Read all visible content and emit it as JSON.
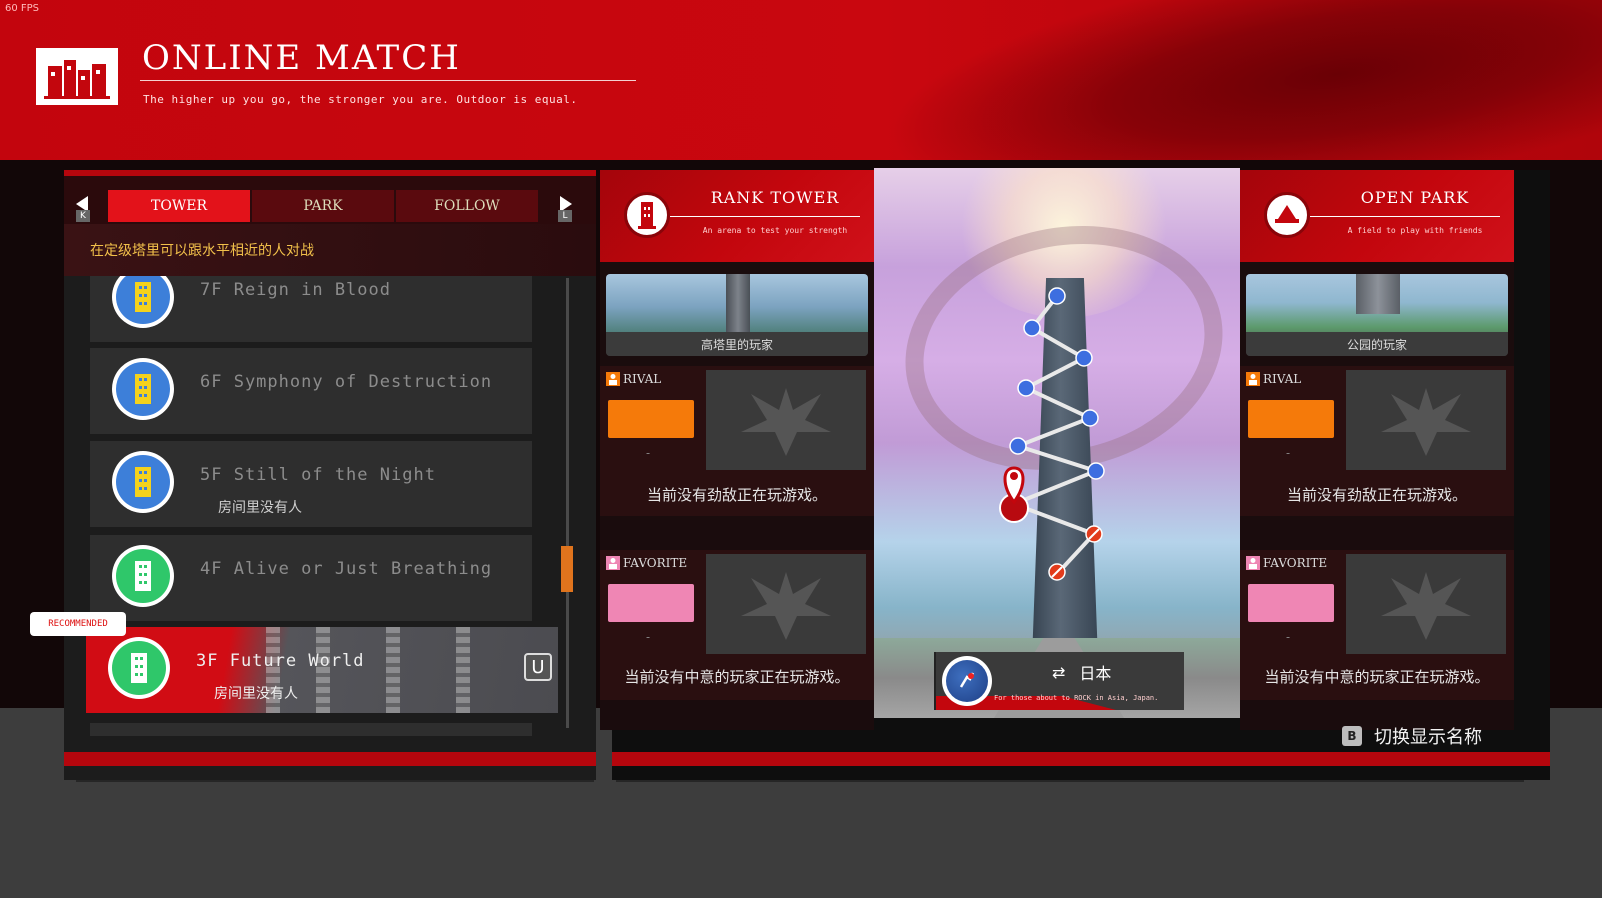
{
  "fps": "60 FPS",
  "header": {
    "title": "ONLINE MATCH",
    "subtitle": "The higher up you go, the stronger you are. Outdoor is equal."
  },
  "tabs": [
    {
      "label": "TOWER",
      "active": true
    },
    {
      "label": "PARK",
      "active": false
    },
    {
      "label": "FOLLOW",
      "active": false
    }
  ],
  "tab_keys": {
    "prev": "K",
    "next": "L"
  },
  "hint": "在定级塔里可以跟水平相近的人对战",
  "floors": [
    {
      "name": "7F Reign in Blood",
      "sub": "",
      "badge_color": "#3d7fd9"
    },
    {
      "name": "6F Symphony of Destruction",
      "sub": "",
      "badge_color": "#3d7fd9"
    },
    {
      "name": "5F Still of the Night",
      "sub": "房间里没有人",
      "badge_color": "#3d7fd9"
    },
    {
      "name": "4F Alive or Just Breathing",
      "sub": "",
      "badge_color": "#2fc76a"
    },
    {
      "name": "3F Future World",
      "sub": "房间里没有人",
      "badge_color": "#2fc76a",
      "selected": true,
      "key": "U"
    }
  ],
  "recommended_label": "RECOMMENDED",
  "scroll": {
    "position": 0.6
  },
  "modes": {
    "tower": {
      "title": "RANK TOWER",
      "subtitle": "An arena to test your strength",
      "preview_caption": "高塔里的玩家",
      "rival": {
        "label": "RIVAL",
        "swatch": "#f57a0a",
        "dash": "-",
        "message": "当前没有劲敌正在玩游戏。"
      },
      "favorite": {
        "label": "FAVORITE",
        "swatch": "#ef86b4",
        "dash": "-",
        "message": "当前没有中意的玩家正在玩游戏。"
      }
    },
    "park": {
      "title": "OPEN PARK",
      "subtitle": "A field to play with friends",
      "preview_caption": "公园的玩家",
      "rival": {
        "label": "RIVAL",
        "swatch": "#f57a0a",
        "dash": "-",
        "message": "当前没有劲敌正在玩游戏。"
      },
      "favorite": {
        "label": "FAVORITE",
        "swatch": "#ef86b4",
        "dash": "-",
        "message": "当前没有中意的玩家正在玩游戏。"
      }
    }
  },
  "region": {
    "name": "日本",
    "subtitle": "For those about to ROCK in Asia, Japan."
  },
  "bottom_hint": {
    "key": "B",
    "label": "切换显示名称"
  },
  "colors": {
    "accent_red": "#c3060d",
    "tab_active": "#e3121a",
    "hint_yellow": "#f1c04a",
    "scroll_thumb": "#e0741d"
  }
}
